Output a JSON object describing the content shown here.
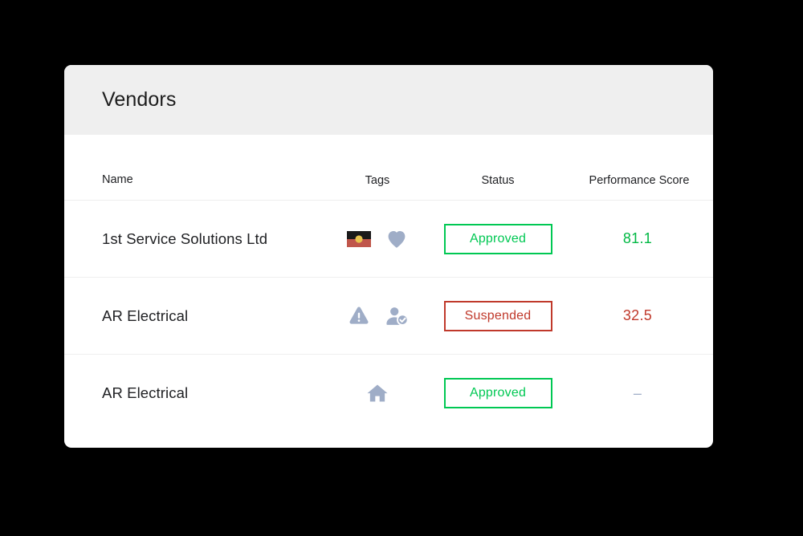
{
  "card": {
    "title": "Vendors"
  },
  "table": {
    "columns": [
      {
        "key": "name",
        "label": "Name"
      },
      {
        "key": "tags",
        "label": "Tags"
      },
      {
        "key": "status",
        "label": "Status"
      },
      {
        "key": "score",
        "label": "Performance Score"
      }
    ],
    "rows": [
      {
        "name": "1st Service Solutions Ltd",
        "tags": [
          "aboriginal-flag-icon",
          "heart-icon"
        ],
        "status": "Approved",
        "status_type": "approved",
        "score": "81.1",
        "score_type": "good"
      },
      {
        "name": "AR Electrical",
        "tags": [
          "warning-triangle-icon",
          "person-verified-icon"
        ],
        "status": "Suspended",
        "status_type": "suspended",
        "score": "32.5",
        "score_type": "bad"
      },
      {
        "name": "AR Electrical",
        "tags": [
          "home-icon"
        ],
        "status": "Approved",
        "status_type": "approved",
        "score": "–",
        "score_type": "empty"
      }
    ]
  },
  "colors": {
    "page_background": "#000000",
    "card_background": "#ffffff",
    "header_background": "#efefef",
    "approved": "#00c853",
    "suspended": "#c0392b",
    "score_good": "#00b843",
    "score_bad": "#c0392b",
    "icon_muted": "#9fadc7",
    "flag_black": "#1a1a1a",
    "flag_red": "#c0564b",
    "flag_yellow": "#e8c44e",
    "divider": "#efefef",
    "text_primary": "#202124"
  }
}
